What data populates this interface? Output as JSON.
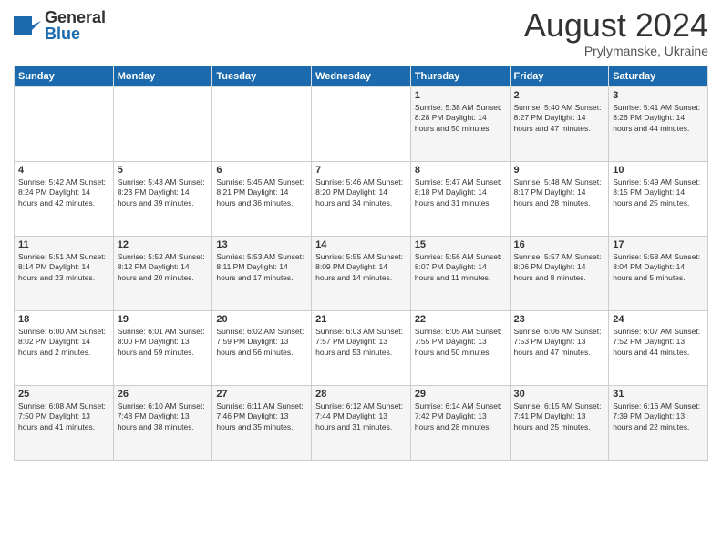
{
  "logo": {
    "general": "General",
    "blue": "Blue"
  },
  "title": "August 2024",
  "location": "Prylymanske, Ukraine",
  "days_of_week": [
    "Sunday",
    "Monday",
    "Tuesday",
    "Wednesday",
    "Thursday",
    "Friday",
    "Saturday"
  ],
  "weeks": [
    [
      {
        "num": "",
        "info": ""
      },
      {
        "num": "",
        "info": ""
      },
      {
        "num": "",
        "info": ""
      },
      {
        "num": "",
        "info": ""
      },
      {
        "num": "1",
        "info": "Sunrise: 5:38 AM\nSunset: 8:28 PM\nDaylight: 14 hours\nand 50 minutes."
      },
      {
        "num": "2",
        "info": "Sunrise: 5:40 AM\nSunset: 8:27 PM\nDaylight: 14 hours\nand 47 minutes."
      },
      {
        "num": "3",
        "info": "Sunrise: 5:41 AM\nSunset: 8:26 PM\nDaylight: 14 hours\nand 44 minutes."
      }
    ],
    [
      {
        "num": "4",
        "info": "Sunrise: 5:42 AM\nSunset: 8:24 PM\nDaylight: 14 hours\nand 42 minutes."
      },
      {
        "num": "5",
        "info": "Sunrise: 5:43 AM\nSunset: 8:23 PM\nDaylight: 14 hours\nand 39 minutes."
      },
      {
        "num": "6",
        "info": "Sunrise: 5:45 AM\nSunset: 8:21 PM\nDaylight: 14 hours\nand 36 minutes."
      },
      {
        "num": "7",
        "info": "Sunrise: 5:46 AM\nSunset: 8:20 PM\nDaylight: 14 hours\nand 34 minutes."
      },
      {
        "num": "8",
        "info": "Sunrise: 5:47 AM\nSunset: 8:18 PM\nDaylight: 14 hours\nand 31 minutes."
      },
      {
        "num": "9",
        "info": "Sunrise: 5:48 AM\nSunset: 8:17 PM\nDaylight: 14 hours\nand 28 minutes."
      },
      {
        "num": "10",
        "info": "Sunrise: 5:49 AM\nSunset: 8:15 PM\nDaylight: 14 hours\nand 25 minutes."
      }
    ],
    [
      {
        "num": "11",
        "info": "Sunrise: 5:51 AM\nSunset: 8:14 PM\nDaylight: 14 hours\nand 23 minutes."
      },
      {
        "num": "12",
        "info": "Sunrise: 5:52 AM\nSunset: 8:12 PM\nDaylight: 14 hours\nand 20 minutes."
      },
      {
        "num": "13",
        "info": "Sunrise: 5:53 AM\nSunset: 8:11 PM\nDaylight: 14 hours\nand 17 minutes."
      },
      {
        "num": "14",
        "info": "Sunrise: 5:55 AM\nSunset: 8:09 PM\nDaylight: 14 hours\nand 14 minutes."
      },
      {
        "num": "15",
        "info": "Sunrise: 5:56 AM\nSunset: 8:07 PM\nDaylight: 14 hours\nand 11 minutes."
      },
      {
        "num": "16",
        "info": "Sunrise: 5:57 AM\nSunset: 8:06 PM\nDaylight: 14 hours\nand 8 minutes."
      },
      {
        "num": "17",
        "info": "Sunrise: 5:58 AM\nSunset: 8:04 PM\nDaylight: 14 hours\nand 5 minutes."
      }
    ],
    [
      {
        "num": "18",
        "info": "Sunrise: 6:00 AM\nSunset: 8:02 PM\nDaylight: 14 hours\nand 2 minutes."
      },
      {
        "num": "19",
        "info": "Sunrise: 6:01 AM\nSunset: 8:00 PM\nDaylight: 13 hours\nand 59 minutes."
      },
      {
        "num": "20",
        "info": "Sunrise: 6:02 AM\nSunset: 7:59 PM\nDaylight: 13 hours\nand 56 minutes."
      },
      {
        "num": "21",
        "info": "Sunrise: 6:03 AM\nSunset: 7:57 PM\nDaylight: 13 hours\nand 53 minutes."
      },
      {
        "num": "22",
        "info": "Sunrise: 6:05 AM\nSunset: 7:55 PM\nDaylight: 13 hours\nand 50 minutes."
      },
      {
        "num": "23",
        "info": "Sunrise: 6:06 AM\nSunset: 7:53 PM\nDaylight: 13 hours\nand 47 minutes."
      },
      {
        "num": "24",
        "info": "Sunrise: 6:07 AM\nSunset: 7:52 PM\nDaylight: 13 hours\nand 44 minutes."
      }
    ],
    [
      {
        "num": "25",
        "info": "Sunrise: 6:08 AM\nSunset: 7:50 PM\nDaylight: 13 hours\nand 41 minutes."
      },
      {
        "num": "26",
        "info": "Sunrise: 6:10 AM\nSunset: 7:48 PM\nDaylight: 13 hours\nand 38 minutes."
      },
      {
        "num": "27",
        "info": "Sunrise: 6:11 AM\nSunset: 7:46 PM\nDaylight: 13 hours\nand 35 minutes."
      },
      {
        "num": "28",
        "info": "Sunrise: 6:12 AM\nSunset: 7:44 PM\nDaylight: 13 hours\nand 31 minutes."
      },
      {
        "num": "29",
        "info": "Sunrise: 6:14 AM\nSunset: 7:42 PM\nDaylight: 13 hours\nand 28 minutes."
      },
      {
        "num": "30",
        "info": "Sunrise: 6:15 AM\nSunset: 7:41 PM\nDaylight: 13 hours\nand 25 minutes."
      },
      {
        "num": "31",
        "info": "Sunrise: 6:16 AM\nSunset: 7:39 PM\nDaylight: 13 hours\nand 22 minutes."
      }
    ]
  ]
}
